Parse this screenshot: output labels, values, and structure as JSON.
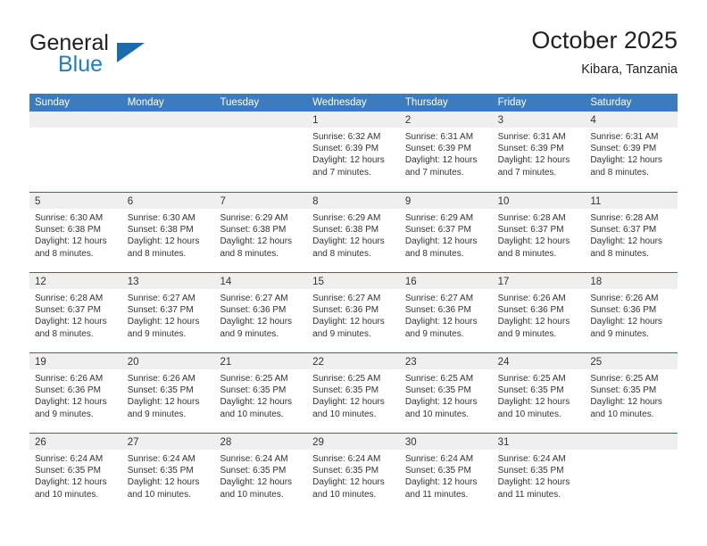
{
  "brand": {
    "name_part1": "General",
    "name_part2": "Blue"
  },
  "header": {
    "title": "October 2025",
    "location": "Kibara, Tanzania"
  },
  "weekdays": [
    "Sunday",
    "Monday",
    "Tuesday",
    "Wednesday",
    "Thursday",
    "Friday",
    "Saturday"
  ],
  "colors": {
    "header_blue": "#3a7cbe",
    "row_divider_blue": "#2b6ca8",
    "day_band_gray": "#efefef",
    "brand_blue": "#1f7ec4",
    "text": "#333333"
  },
  "weeks": [
    [
      {
        "day": "",
        "sunrise": "",
        "sunset": "",
        "daylight": "",
        "daylight2": ""
      },
      {
        "day": "",
        "sunrise": "",
        "sunset": "",
        "daylight": "",
        "daylight2": ""
      },
      {
        "day": "",
        "sunrise": "",
        "sunset": "",
        "daylight": "",
        "daylight2": ""
      },
      {
        "day": "1",
        "sunrise": "Sunrise: 6:32 AM",
        "sunset": "Sunset: 6:39 PM",
        "daylight": "Daylight: 12 hours",
        "daylight2": "and 7 minutes."
      },
      {
        "day": "2",
        "sunrise": "Sunrise: 6:31 AM",
        "sunset": "Sunset: 6:39 PM",
        "daylight": "Daylight: 12 hours",
        "daylight2": "and 7 minutes."
      },
      {
        "day": "3",
        "sunrise": "Sunrise: 6:31 AM",
        "sunset": "Sunset: 6:39 PM",
        "daylight": "Daylight: 12 hours",
        "daylight2": "and 7 minutes."
      },
      {
        "day": "4",
        "sunrise": "Sunrise: 6:31 AM",
        "sunset": "Sunset: 6:39 PM",
        "daylight": "Daylight: 12 hours",
        "daylight2": "and 8 minutes."
      }
    ],
    [
      {
        "day": "5",
        "sunrise": "Sunrise: 6:30 AM",
        "sunset": "Sunset: 6:38 PM",
        "daylight": "Daylight: 12 hours",
        "daylight2": "and 8 minutes."
      },
      {
        "day": "6",
        "sunrise": "Sunrise: 6:30 AM",
        "sunset": "Sunset: 6:38 PM",
        "daylight": "Daylight: 12 hours",
        "daylight2": "and 8 minutes."
      },
      {
        "day": "7",
        "sunrise": "Sunrise: 6:29 AM",
        "sunset": "Sunset: 6:38 PM",
        "daylight": "Daylight: 12 hours",
        "daylight2": "and 8 minutes."
      },
      {
        "day": "8",
        "sunrise": "Sunrise: 6:29 AM",
        "sunset": "Sunset: 6:38 PM",
        "daylight": "Daylight: 12 hours",
        "daylight2": "and 8 minutes."
      },
      {
        "day": "9",
        "sunrise": "Sunrise: 6:29 AM",
        "sunset": "Sunset: 6:37 PM",
        "daylight": "Daylight: 12 hours",
        "daylight2": "and 8 minutes."
      },
      {
        "day": "10",
        "sunrise": "Sunrise: 6:28 AM",
        "sunset": "Sunset: 6:37 PM",
        "daylight": "Daylight: 12 hours",
        "daylight2": "and 8 minutes."
      },
      {
        "day": "11",
        "sunrise": "Sunrise: 6:28 AM",
        "sunset": "Sunset: 6:37 PM",
        "daylight": "Daylight: 12 hours",
        "daylight2": "and 8 minutes."
      }
    ],
    [
      {
        "day": "12",
        "sunrise": "Sunrise: 6:28 AM",
        "sunset": "Sunset: 6:37 PM",
        "daylight": "Daylight: 12 hours",
        "daylight2": "and 8 minutes."
      },
      {
        "day": "13",
        "sunrise": "Sunrise: 6:27 AM",
        "sunset": "Sunset: 6:37 PM",
        "daylight": "Daylight: 12 hours",
        "daylight2": "and 9 minutes."
      },
      {
        "day": "14",
        "sunrise": "Sunrise: 6:27 AM",
        "sunset": "Sunset: 6:36 PM",
        "daylight": "Daylight: 12 hours",
        "daylight2": "and 9 minutes."
      },
      {
        "day": "15",
        "sunrise": "Sunrise: 6:27 AM",
        "sunset": "Sunset: 6:36 PM",
        "daylight": "Daylight: 12 hours",
        "daylight2": "and 9 minutes."
      },
      {
        "day": "16",
        "sunrise": "Sunrise: 6:27 AM",
        "sunset": "Sunset: 6:36 PM",
        "daylight": "Daylight: 12 hours",
        "daylight2": "and 9 minutes."
      },
      {
        "day": "17",
        "sunrise": "Sunrise: 6:26 AM",
        "sunset": "Sunset: 6:36 PM",
        "daylight": "Daylight: 12 hours",
        "daylight2": "and 9 minutes."
      },
      {
        "day": "18",
        "sunrise": "Sunrise: 6:26 AM",
        "sunset": "Sunset: 6:36 PM",
        "daylight": "Daylight: 12 hours",
        "daylight2": "and 9 minutes."
      }
    ],
    [
      {
        "day": "19",
        "sunrise": "Sunrise: 6:26 AM",
        "sunset": "Sunset: 6:36 PM",
        "daylight": "Daylight: 12 hours",
        "daylight2": "and 9 minutes."
      },
      {
        "day": "20",
        "sunrise": "Sunrise: 6:26 AM",
        "sunset": "Sunset: 6:35 PM",
        "daylight": "Daylight: 12 hours",
        "daylight2": "and 9 minutes."
      },
      {
        "day": "21",
        "sunrise": "Sunrise: 6:25 AM",
        "sunset": "Sunset: 6:35 PM",
        "daylight": "Daylight: 12 hours",
        "daylight2": "and 10 minutes."
      },
      {
        "day": "22",
        "sunrise": "Sunrise: 6:25 AM",
        "sunset": "Sunset: 6:35 PM",
        "daylight": "Daylight: 12 hours",
        "daylight2": "and 10 minutes."
      },
      {
        "day": "23",
        "sunrise": "Sunrise: 6:25 AM",
        "sunset": "Sunset: 6:35 PM",
        "daylight": "Daylight: 12 hours",
        "daylight2": "and 10 minutes."
      },
      {
        "day": "24",
        "sunrise": "Sunrise: 6:25 AM",
        "sunset": "Sunset: 6:35 PM",
        "daylight": "Daylight: 12 hours",
        "daylight2": "and 10 minutes."
      },
      {
        "day": "25",
        "sunrise": "Sunrise: 6:25 AM",
        "sunset": "Sunset: 6:35 PM",
        "daylight": "Daylight: 12 hours",
        "daylight2": "and 10 minutes."
      }
    ],
    [
      {
        "day": "26",
        "sunrise": "Sunrise: 6:24 AM",
        "sunset": "Sunset: 6:35 PM",
        "daylight": "Daylight: 12 hours",
        "daylight2": "and 10 minutes."
      },
      {
        "day": "27",
        "sunrise": "Sunrise: 6:24 AM",
        "sunset": "Sunset: 6:35 PM",
        "daylight": "Daylight: 12 hours",
        "daylight2": "and 10 minutes."
      },
      {
        "day": "28",
        "sunrise": "Sunrise: 6:24 AM",
        "sunset": "Sunset: 6:35 PM",
        "daylight": "Daylight: 12 hours",
        "daylight2": "and 10 minutes."
      },
      {
        "day": "29",
        "sunrise": "Sunrise: 6:24 AM",
        "sunset": "Sunset: 6:35 PM",
        "daylight": "Daylight: 12 hours",
        "daylight2": "and 10 minutes."
      },
      {
        "day": "30",
        "sunrise": "Sunrise: 6:24 AM",
        "sunset": "Sunset: 6:35 PM",
        "daylight": "Daylight: 12 hours",
        "daylight2": "and 11 minutes."
      },
      {
        "day": "31",
        "sunrise": "Sunrise: 6:24 AM",
        "sunset": "Sunset: 6:35 PM",
        "daylight": "Daylight: 12 hours",
        "daylight2": "and 11 minutes."
      },
      {
        "day": "",
        "sunrise": "",
        "sunset": "",
        "daylight": "",
        "daylight2": ""
      }
    ]
  ]
}
